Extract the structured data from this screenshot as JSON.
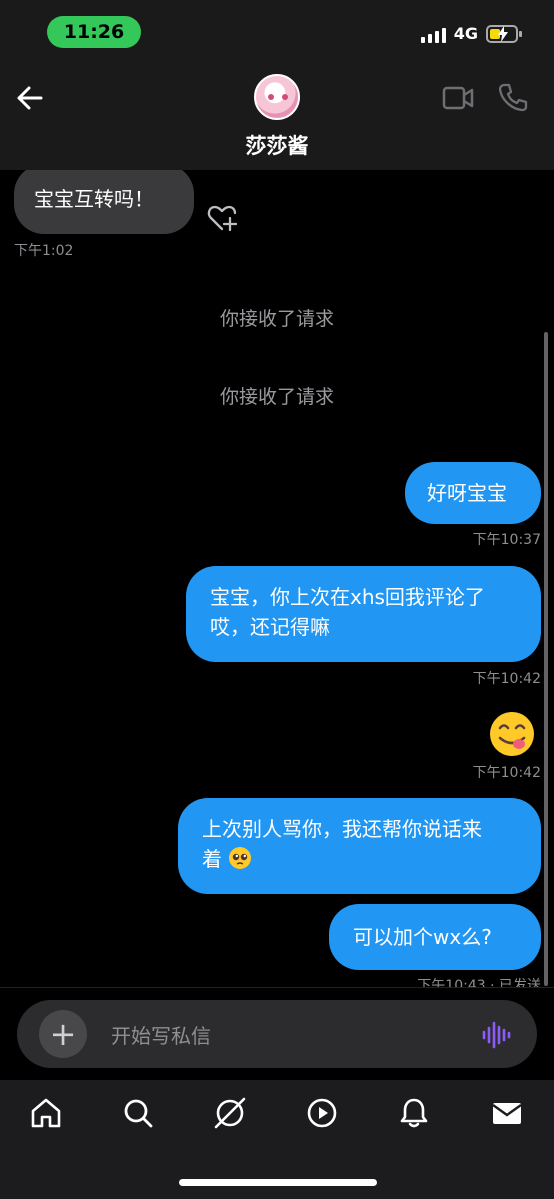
{
  "status": {
    "time": "11:26",
    "network": "4G"
  },
  "header": {
    "title": "莎莎酱"
  },
  "messages": {
    "m1": {
      "text": "宝宝互转吗！",
      "time": "下午1:02"
    },
    "sys1": "你接收了请求",
    "sys2": "你接收了请求",
    "m2": {
      "text": "好呀宝宝",
      "time": "下午10:37"
    },
    "m3": {
      "line1": "宝宝，你上次在xhs回我评论了",
      "line2": "哎，还记得嘛",
      "time": "下午10:42"
    },
    "m4": {
      "emoji": "😋",
      "time": "下午10:42"
    },
    "m5": {
      "line1": "上次别人骂你，我还帮你说话来",
      "line2": "着",
      "emoji": "🥺"
    },
    "m6": {
      "text": "可以加个wx么?",
      "time": "下午10:43 · 已发送"
    }
  },
  "composer": {
    "plus": "+",
    "placeholder": "开始写私信"
  },
  "colors": {
    "accent": "#2196f3",
    "incoming_bubble": "#3a3a3c",
    "status_pill": "#34c759",
    "voice_icon": "#8b5cf6"
  },
  "nav": [
    "home-icon",
    "search-icon",
    "explore-icon",
    "video-icon",
    "bell-icon",
    "mail-icon"
  ]
}
